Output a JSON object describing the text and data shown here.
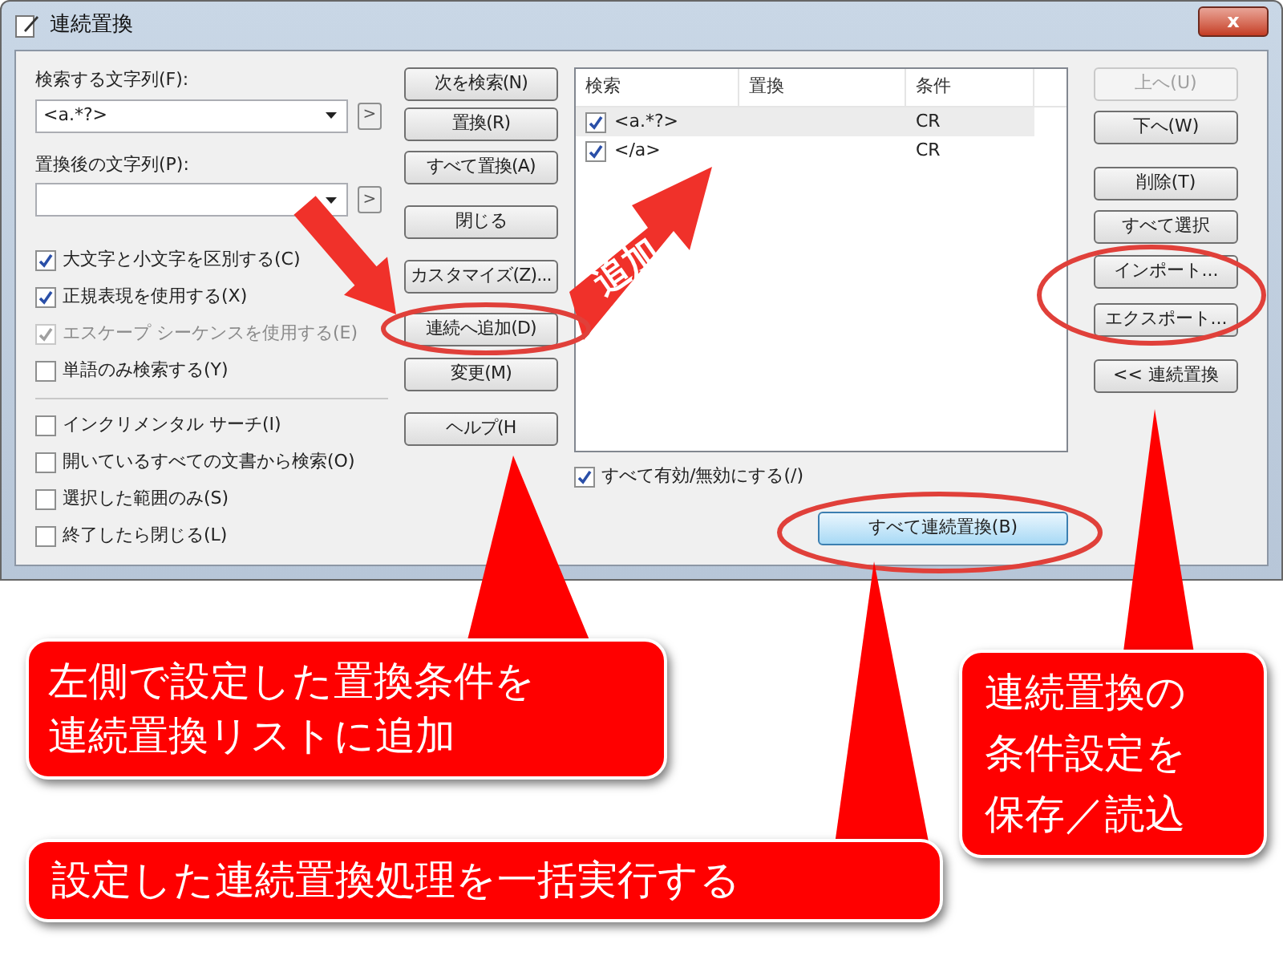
{
  "window": {
    "title": "連続置換",
    "close_label": "x"
  },
  "search": {
    "label": "検索する文字列(F):",
    "value": "<a.*?>",
    "arrow_label": ">"
  },
  "replace": {
    "label": "置換後の文字列(P):",
    "arrow_label": ">"
  },
  "options": [
    {
      "label": "大文字と小文字を区別する(C)",
      "checked": true,
      "disabled": false
    },
    {
      "label": "正規表現を使用する(X)",
      "checked": true,
      "disabled": false
    },
    {
      "label": "エスケープ シーケンスを使用する(E)",
      "checked": true,
      "disabled": true
    },
    {
      "label": "単語のみ検索する(Y)",
      "checked": false,
      "disabled": false
    }
  ],
  "more_options": [
    {
      "label": "インクリメンタル サーチ(I)",
      "checked": false
    },
    {
      "label": "開いているすべての文書から検索(O)",
      "checked": false
    },
    {
      "label": "選択した範囲のみ(S)",
      "checked": false
    },
    {
      "label": "終了したら閉じる(L)",
      "checked": false
    }
  ],
  "action_buttons": [
    "次を検索(N)",
    "置換(R)",
    "すべて置換(A)",
    "閉じる",
    "カスタマイズ(Z)...",
    "連続へ追加(D)",
    "変更(M)",
    "ヘルプ(H"
  ],
  "list": {
    "columns": [
      "検索",
      "置換",
      "条件"
    ],
    "rows": [
      {
        "checked": true,
        "search": "<a.*?>",
        "condition": "CR",
        "selected": true
      },
      {
        "checked": true,
        "search": "</a>",
        "condition": "CR",
        "selected": false
      }
    ]
  },
  "toggle_all": {
    "label": "すべて有効/無効にする(/)",
    "checked": true
  },
  "run_button": {
    "label": "すべて連続置換(B)"
  },
  "side_buttons": [
    {
      "label": "上へ(U)",
      "disabled": true
    },
    {
      "label": "下へ(W)",
      "disabled": false
    },
    {
      "label": "削除(T)",
      "disabled": false
    },
    {
      "label": "すべて選択",
      "disabled": false
    },
    {
      "label": "インポート...",
      "disabled": false
    },
    {
      "label": "エクスポート...",
      "disabled": false
    },
    {
      "label": "<< 連続置換",
      "disabled": false
    }
  ],
  "annotations": {
    "arrow_label": "追加",
    "callouts": [
      {
        "lines": [
          "左側で設定した置換条件を",
          "連続置換リストに追加"
        ]
      },
      {
        "lines": [
          "設定した連続置換処理を一括実行する"
        ]
      },
      {
        "lines": [
          "連続置換の",
          "条件設定を",
          "保存／読込"
        ]
      }
    ]
  }
}
